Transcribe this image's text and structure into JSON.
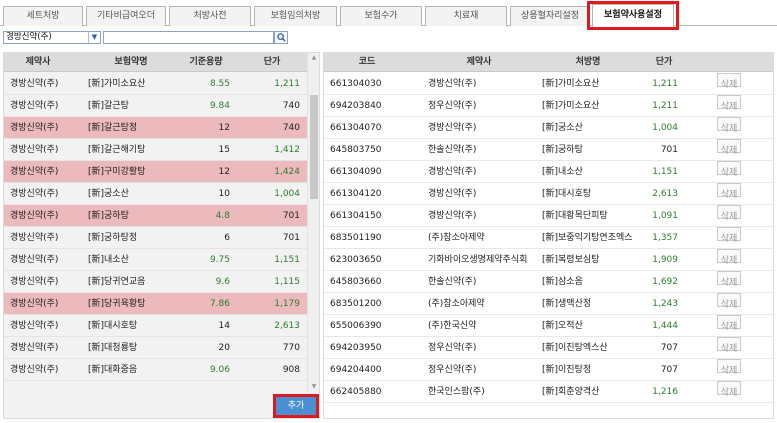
{
  "tabs": [
    {
      "label": "세트처방",
      "active": false
    },
    {
      "label": "기타비급여오더",
      "active": false
    },
    {
      "label": "처방사전",
      "active": false
    },
    {
      "label": "보험임의처방",
      "active": false
    },
    {
      "label": "보험수가",
      "active": false
    },
    {
      "label": "치료재",
      "active": false
    },
    {
      "label": "상용혈자리설정",
      "active": false
    },
    {
      "label": "보험약사용설정",
      "active": true
    }
  ],
  "search": {
    "company_selected": "경방신약(주)",
    "query": ""
  },
  "left_table": {
    "headers": [
      "제약사",
      "보험약명",
      "기준용량",
      "단가"
    ],
    "rows": [
      {
        "company": "경방신약(주)",
        "name": "[新]가미소요산",
        "dose": "8.55",
        "price": "1,211",
        "highlight": false
      },
      {
        "company": "경방신약(주)",
        "name": "[新]갈근탕",
        "dose": "9.84",
        "price": "740",
        "highlight": false
      },
      {
        "company": "경방신약(주)",
        "name": "[新]갈근탕정",
        "dose": "12",
        "price": "740",
        "highlight": true
      },
      {
        "company": "경방신약(주)",
        "name": "[新]갈근해기탕",
        "dose": "15",
        "price": "1,412",
        "highlight": false
      },
      {
        "company": "경방신약(주)",
        "name": "[新]구미강활탕",
        "dose": "12",
        "price": "1,424",
        "highlight": true
      },
      {
        "company": "경방신약(주)",
        "name": "[新]궁소산",
        "dose": "10",
        "price": "1,004",
        "highlight": false
      },
      {
        "company": "경방신약(주)",
        "name": "[新]궁하탕",
        "dose": "4.8",
        "price": "701",
        "highlight": true
      },
      {
        "company": "경방신약(주)",
        "name": "[新]궁하탕정",
        "dose": "6",
        "price": "701",
        "highlight": false
      },
      {
        "company": "경방신약(주)",
        "name": "[新]내소산",
        "dose": "9.75",
        "price": "1,151",
        "highlight": false
      },
      {
        "company": "경방신약(주)",
        "name": "[新]당귀연교음",
        "dose": "9.6",
        "price": "1,115",
        "highlight": false
      },
      {
        "company": "경방신약(주)",
        "name": "[新]당귀육황탕",
        "dose": "7.86",
        "price": "1,179",
        "highlight": true
      },
      {
        "company": "경방신약(주)",
        "name": "[新]대시호탕",
        "dose": "14",
        "price": "2,613",
        "highlight": false
      },
      {
        "company": "경방신약(주)",
        "name": "[新]대청룡탕",
        "dose": "20",
        "price": "770",
        "highlight": false
      },
      {
        "company": "경방신약(주)",
        "name": "[新]대화중음",
        "dose": "9.06",
        "price": "908",
        "highlight": false
      }
    ],
    "add_label": "추가"
  },
  "right_table": {
    "headers": [
      "코드",
      "제약사",
      "처방명",
      "단가"
    ],
    "rows": [
      {
        "code": "661304030",
        "company": "경방신약(주)",
        "name": "[新]가미소요산",
        "price": "1,211"
      },
      {
        "code": "694203840",
        "company": "정우신약(주)",
        "name": "[新]가미소요산",
        "price": "1,211"
      },
      {
        "code": "661304070",
        "company": "경방신약(주)",
        "name": "[新]궁소산",
        "price": "1,004"
      },
      {
        "code": "645803750",
        "company": "한솔신약(주)",
        "name": "[新]궁하탕",
        "price": "701"
      },
      {
        "code": "661304090",
        "company": "경방신약(주)",
        "name": "[新]내소산",
        "price": "1,151"
      },
      {
        "code": "661304120",
        "company": "경방신약(주)",
        "name": "[新]대시호탕",
        "price": "2,613"
      },
      {
        "code": "661304150",
        "company": "경방신약(주)",
        "name": "[新]대황목단피탕",
        "price": "1,091"
      },
      {
        "code": "683501190",
        "company": "(주)참소아제약",
        "name": "[新]보중익기탕연조엑스",
        "price": "1,357"
      },
      {
        "code": "623003650",
        "company": "기화바이오생명제약주식회",
        "name": "[新]복령보심탕",
        "price": "1,909"
      },
      {
        "code": "645803660",
        "company": "한솔신약(주)",
        "name": "[新]삼소음",
        "price": "1,692"
      },
      {
        "code": "683501200",
        "company": "(주)참소아제약",
        "name": "[新]생맥산정",
        "price": "1,243"
      },
      {
        "code": "655006390",
        "company": "(주)한국신약",
        "name": "[新]오적산",
        "price": "1,444"
      },
      {
        "code": "694203950",
        "company": "정우신약(주)",
        "name": "[新]이진탕엑스산",
        "price": "707"
      },
      {
        "code": "694204400",
        "company": "정우신약(주)",
        "name": "[新]이진탕정",
        "price": "707"
      },
      {
        "code": "662405880",
        "company": "한국인스팜(주)",
        "name": "[新]회춘양격산",
        "price": "1,216"
      }
    ],
    "delete_label": "삭제"
  },
  "colors": {
    "price_green": "#2e7d2e",
    "row_highlight": "#ecb9bc",
    "add_button": "#4a8fcf",
    "callout_red": "#e0191f"
  }
}
